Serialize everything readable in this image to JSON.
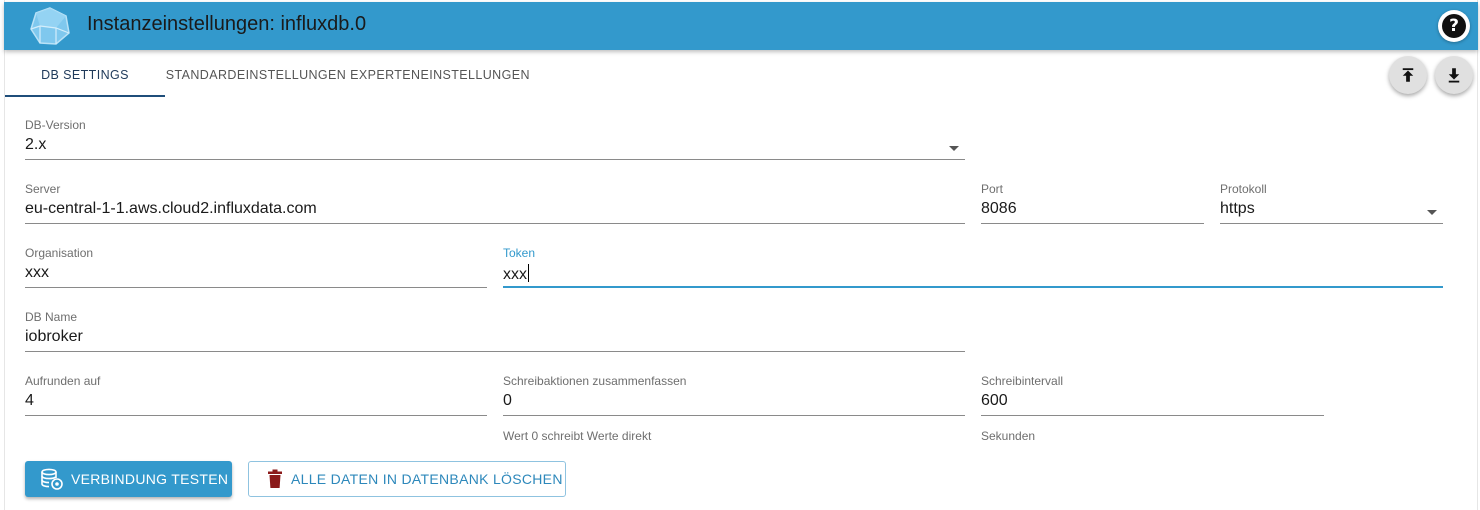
{
  "header": {
    "title": "Instanzeinstellungen: influxdb.0",
    "logo_icon": "influxdb-logo-icon",
    "help_icon": "help-circle-icon",
    "help_glyph": "?"
  },
  "tabs": [
    {
      "label": "DB Settings",
      "active": true
    },
    {
      "label": "Standardeinstellungen",
      "active": false
    },
    {
      "label": "Experteneinstellungen",
      "active": false
    }
  ],
  "toolbar": {
    "upload_icon": "upload-icon",
    "download_icon": "download-icon"
  },
  "form": {
    "db_version": {
      "label": "DB-Version",
      "value": "2.x"
    },
    "server": {
      "label": "Server",
      "value": "eu-central-1-1.aws.cloud2.influxdata.com"
    },
    "port": {
      "label": "Port",
      "value": "8086"
    },
    "protocol": {
      "label": "Protokoll",
      "value": "https"
    },
    "organisation": {
      "label": "Organisation",
      "value": "xxx"
    },
    "token": {
      "label": "Token",
      "value": "xxx"
    },
    "db_name": {
      "label": "DB Name",
      "value": "iobroker"
    },
    "round": {
      "label": "Aufrunden auf",
      "value": "4"
    },
    "combine": {
      "label": "Schreibaktionen zusammenfassen",
      "value": "0",
      "helper": "Wert 0 schreibt Werte direkt"
    },
    "interval": {
      "label": "Schreibintervall",
      "value": "600",
      "helper": "Sekunden"
    }
  },
  "buttons": {
    "test_connection": {
      "label": "VERBINDUNG TESTEN",
      "icon": "database-connection-icon"
    },
    "delete_all": {
      "label": "ALLE DATEN IN DATENBANK LÖSCHEN",
      "icon": "trash-icon"
    }
  },
  "colors": {
    "header": "#3399cc",
    "accent": "#3399cc",
    "tab_indicator": "#1f4e7a",
    "delete_icon": "#8b1a1a"
  }
}
